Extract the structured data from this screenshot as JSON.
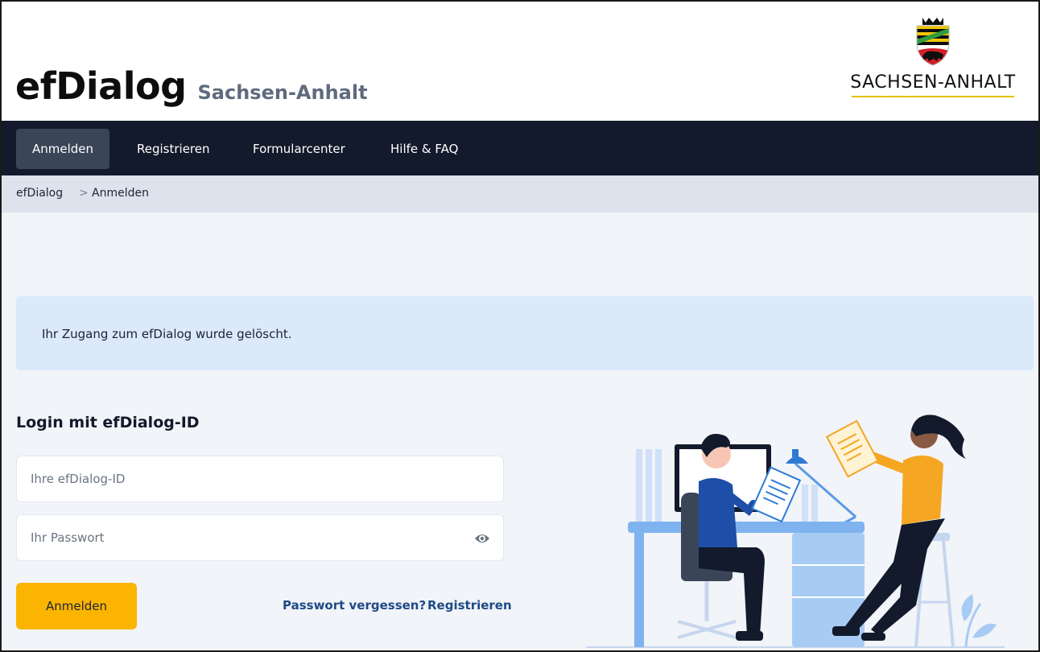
{
  "header": {
    "app_name": "efDialog",
    "region": "Sachsen-Anhalt",
    "logo_text": "SACHSEN-ANHALT"
  },
  "nav": {
    "items": [
      {
        "label": "Anmelden",
        "active": true
      },
      {
        "label": "Registrieren",
        "active": false
      },
      {
        "label": "Formularcenter",
        "active": false
      },
      {
        "label": "Hilfe & FAQ",
        "active": false
      }
    ]
  },
  "breadcrumb": {
    "items": [
      "efDialog",
      "Anmelden"
    ],
    "separator": ">"
  },
  "alert": {
    "message": "Ihr Zugang zum efDialog wurde gelöscht."
  },
  "login": {
    "title": "Login mit efDialog-ID",
    "id_placeholder": "Ihre efDialog-ID",
    "password_placeholder": "Ihr Passwort",
    "submit_label": "Anmelden",
    "forgot_label": "Passwort vergessen?",
    "register_label": "Registrieren"
  },
  "icons": {
    "password_toggle": "eye-icon",
    "breadcrumb_separator": "chevron-right-icon",
    "crest": "coat-of-arms-icon"
  },
  "colors": {
    "nav_bg": "#121a2b",
    "nav_active": "#3a4557",
    "primary_button": "#fbb400",
    "link": "#1f4a87",
    "alert_bg": "#dbe9fb",
    "page_bg": "#f1f4f8"
  }
}
